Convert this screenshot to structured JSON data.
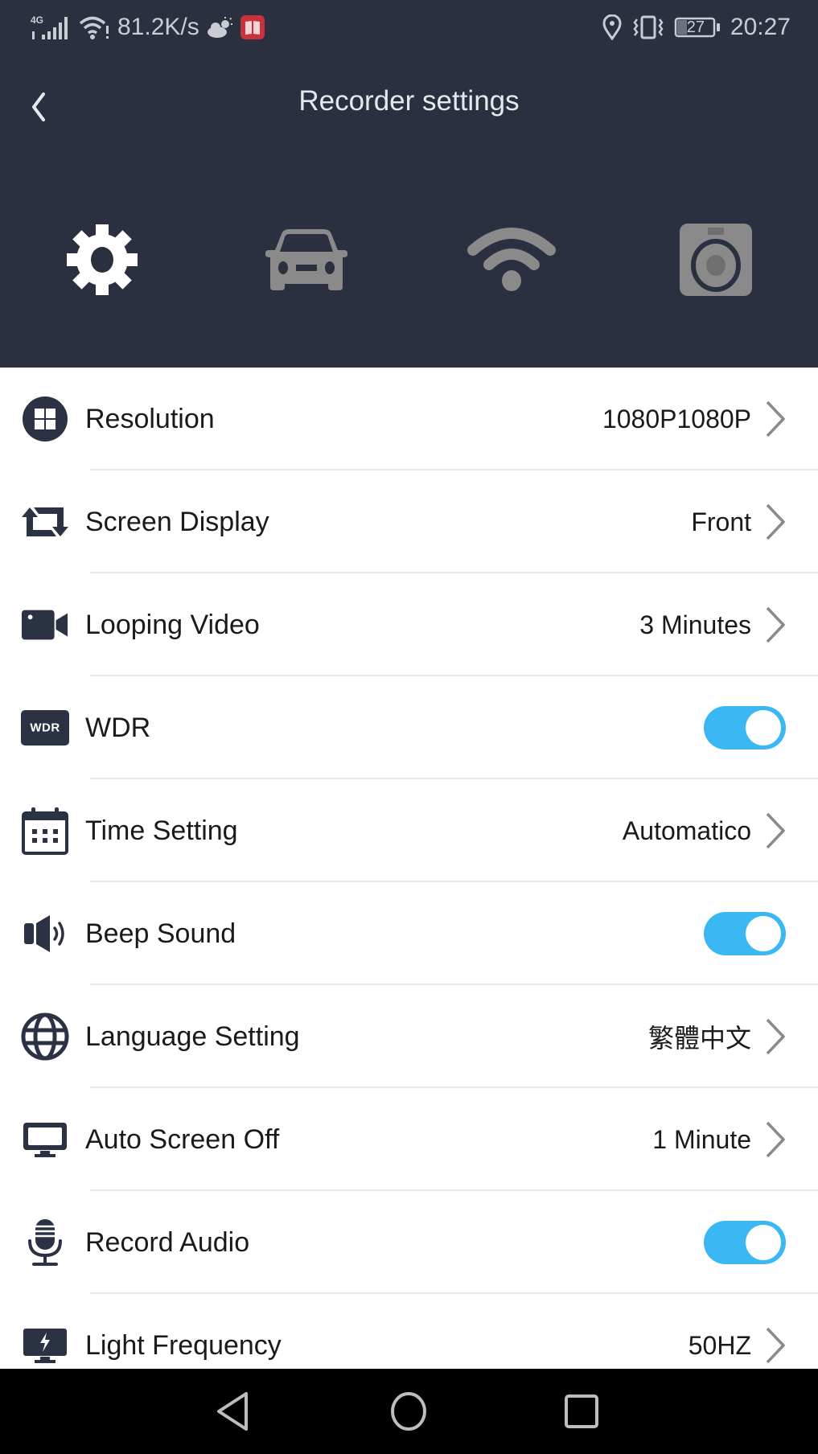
{
  "status_bar": {
    "network_type": "4G",
    "speed": "81.2K/s",
    "battery": "27",
    "time": "20:27",
    "left_icons": [
      "signal-icon",
      "wifi-icon",
      "weather-icon",
      "book-app-icon"
    ],
    "right_icons": [
      "location-icon",
      "vibrate-icon",
      "battery-icon"
    ]
  },
  "header": {
    "title": "Recorder settings",
    "back_icon": "chevron-left-icon",
    "tabs": [
      {
        "name": "settings",
        "icon": "gear-icon",
        "active": true
      },
      {
        "name": "car",
        "icon": "car-icon",
        "active": false
      },
      {
        "name": "wifi",
        "icon": "wifi-icon",
        "active": false
      },
      {
        "name": "camera",
        "icon": "camera-icon",
        "active": false
      }
    ]
  },
  "settings": [
    {
      "label": "Resolution",
      "value": "1080P1080P",
      "type": "select",
      "icon": "grid-icon"
    },
    {
      "label": "Screen Display",
      "value": "Front",
      "type": "select",
      "icon": "repeat-icon"
    },
    {
      "label": "Looping Video",
      "value": "3 Minutes",
      "type": "select",
      "icon": "video-camera-icon"
    },
    {
      "label": "WDR",
      "value": true,
      "type": "toggle",
      "icon": "wdr-icon"
    },
    {
      "label": "Time Setting",
      "value": "Automatico",
      "type": "select",
      "icon": "calendar-icon"
    },
    {
      "label": "Beep Sound",
      "value": true,
      "type": "toggle",
      "icon": "speaker-icon"
    },
    {
      "label": "Language Setting",
      "value": "繁體中文",
      "type": "select",
      "icon": "globe-icon"
    },
    {
      "label": "Auto Screen Off",
      "value": "1 Minute",
      "type": "select",
      "icon": "monitor-icon"
    },
    {
      "label": "Record Audio",
      "value": true,
      "type": "toggle",
      "icon": "microphone-icon"
    },
    {
      "label": "Light Frequency",
      "value": "50HZ",
      "type": "select",
      "icon": "monitor-flash-icon"
    }
  ],
  "wdr_badge_text": "WDR",
  "colors": {
    "header_bg": "#2a3040",
    "toggle_on": "#3bb8f4",
    "icon_dark": "#2b3244",
    "tab_inactive": "#8a8a8a",
    "tab_active": "#ffffff"
  },
  "nav_bar": {
    "buttons": [
      "back-triangle-icon",
      "home-circle-icon",
      "recents-square-icon"
    ]
  }
}
